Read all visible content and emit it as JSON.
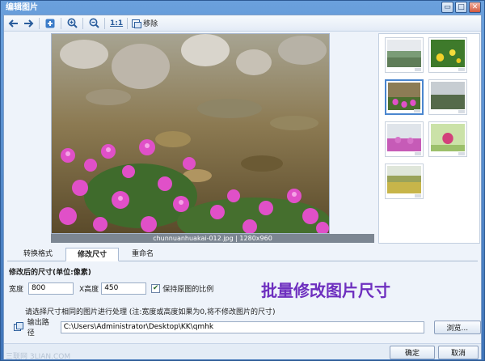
{
  "window": {
    "title": "编辑图片",
    "controls": {
      "minimize": "▭",
      "maximize": "□",
      "close": "✕"
    }
  },
  "toolbar": {
    "back_icon": "arrow-left-icon",
    "forward_icon": "arrow-right-icon",
    "add_icon": "plus-icon",
    "zoom_in_icon": "zoom-in-icon",
    "zoom_out_icon": "zoom-out-icon",
    "actual_size_label": "1:1",
    "remove_label": "移除"
  },
  "preview": {
    "caption": "chunnuanhuakai-012.jpg | 1280x960"
  },
  "thumbnails": {
    "selected_index": 2,
    "count": 7
  },
  "tabs": [
    {
      "label": "转换格式",
      "active": false
    },
    {
      "label": "修改尺寸",
      "active": true
    },
    {
      "label": "重命名",
      "active": false
    }
  ],
  "resize": {
    "section_title": "修改后的尺寸(单位:像素)",
    "width_label": "宽度",
    "width_value": "800",
    "height_label": "X高度",
    "height_value": "450",
    "keep_ratio_label": "保持原图的比例",
    "keep_ratio_checked": true,
    "banner": "批量修改图片尺寸",
    "note": "请选择尺寸相同的图片进行处理 (注:宽度或高度如果为0,将不修改图片的尺寸)",
    "output_label": "输出路径",
    "output_path": "C:\\Users\\Administrator\\Desktop\\KK\\qmhk",
    "browse_label": "浏览..."
  },
  "footer": {
    "ok_label": "确定",
    "cancel_label": "取消",
    "watermark": "三联网 3LIAN.COM"
  },
  "colors": {
    "accent": "#4a86cf",
    "banner": "#6e2fbf"
  }
}
